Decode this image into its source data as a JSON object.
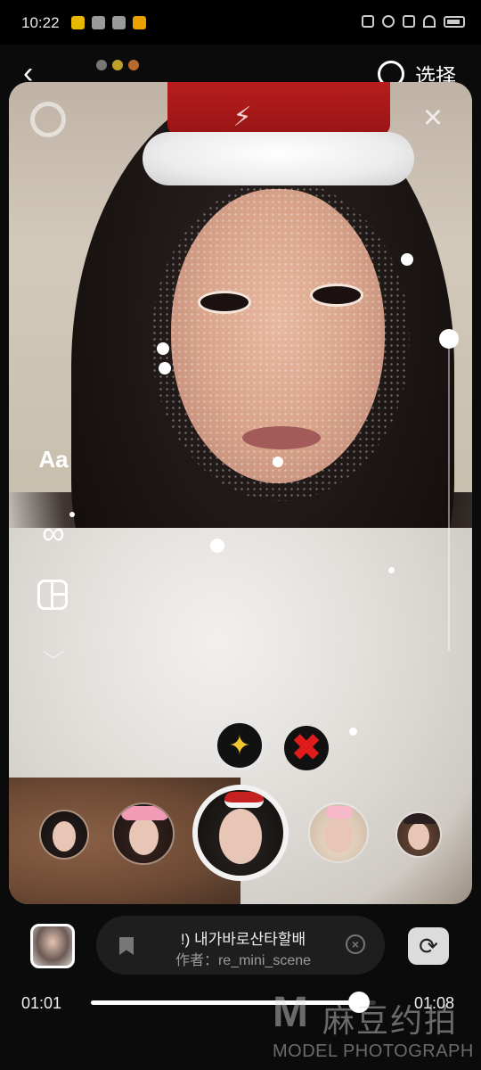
{
  "status_bar": {
    "time": "10:22"
  },
  "nav": {
    "select_label": "选择"
  },
  "tools": {
    "text_label": "Aa",
    "loop_symbol": "∞",
    "more_symbol": "﹀"
  },
  "camera": {
    "zoom_level": 0.15
  },
  "effect": {
    "title": "!) 내가바로산타할배",
    "author": "作者：re_mini_scene"
  },
  "playback": {
    "start_time": "01:01",
    "end_time": "01:08",
    "progress": 0.94
  },
  "watermark": {
    "mark": "M",
    "cn": "麻豆约拍",
    "en": "MODEL PHOTOGRAPH"
  },
  "colors": {
    "accent": "#ffffff",
    "remove_red": "#e01b1b",
    "sparkle_gold": "#f3c52e"
  }
}
